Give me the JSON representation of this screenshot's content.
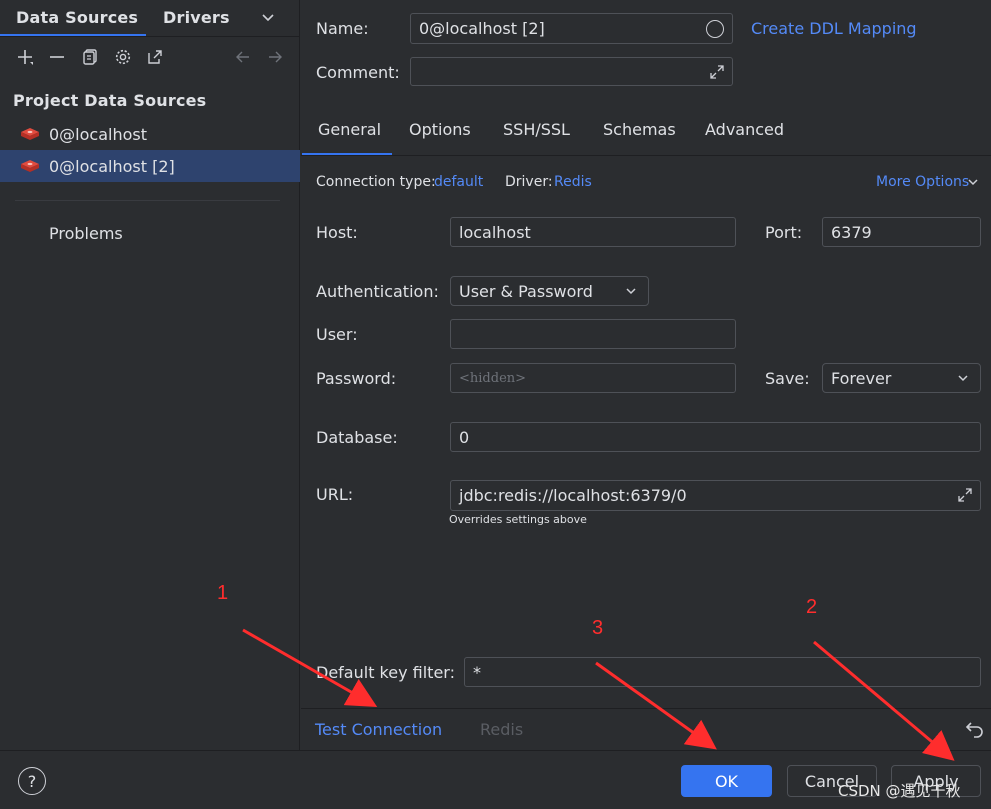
{
  "sidebar": {
    "tabs": [
      "Data Sources",
      "Drivers"
    ],
    "section_title": "Project Data Sources",
    "items": [
      {
        "label": "0@localhost"
      },
      {
        "label": "0@localhost [2]"
      }
    ],
    "problems": "Problems"
  },
  "form": {
    "name_label": "Name:",
    "name_value": "0@localhost [2]",
    "create_ddl": "Create DDL Mapping",
    "comment_label": "Comment:",
    "tabs": [
      "General",
      "Options",
      "SSH/SSL",
      "Schemas",
      "Advanced"
    ],
    "connection_type_label": "Connection type:",
    "connection_type_value": "default",
    "driver_label": "Driver:",
    "driver_value": "Redis",
    "more_options": "More Options",
    "host_label": "Host:",
    "host_value": "localhost",
    "port_label": "Port:",
    "port_value": "6379",
    "auth_label": "Authentication:",
    "auth_value": "User & Password",
    "user_label": "User:",
    "password_label": "Password:",
    "password_placeholder": "<hidden>",
    "save_label": "Save:",
    "save_value": "Forever",
    "database_label": "Database:",
    "database_value": "0",
    "url_label": "URL:",
    "url_value": "jdbc:redis://localhost:6379/0",
    "url_hint": "Overrides settings above",
    "key_filter_label": "Default key filter:",
    "key_filter_value": "*"
  },
  "bottom": {
    "test_connection": "Test Connection",
    "driver_name": "Redis"
  },
  "footer": {
    "help": "?",
    "ok": "OK",
    "cancel": "Cancel",
    "apply": "Apply",
    "watermark": "CSDN @遇见千秋"
  },
  "annotations": [
    "1",
    "2",
    "3"
  ],
  "colors": {
    "accent": "#3574f0",
    "link": "#548af7",
    "annotation": "#ff2d2d"
  }
}
